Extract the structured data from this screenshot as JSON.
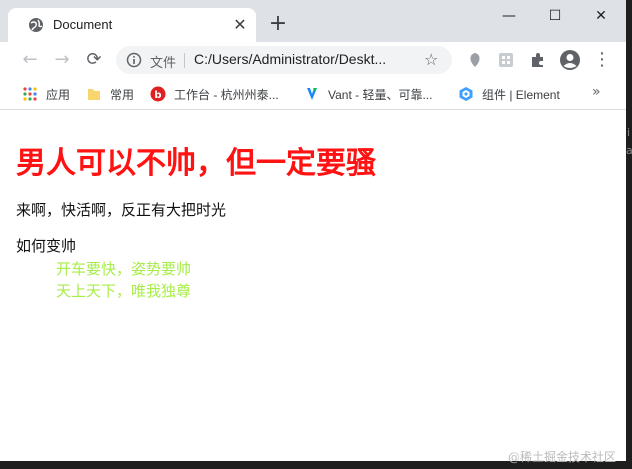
{
  "browser": {
    "tab_title": "Document",
    "tab_close": "✕",
    "new_tab": "+",
    "window_controls": {
      "minimize": "—",
      "maximize": "☐",
      "close": "✕"
    }
  },
  "toolbar": {
    "back_icon": "←",
    "forward_icon": "→",
    "reload_icon": "⟳",
    "address": {
      "scheme_label": "文件",
      "url": "C:/Users/Administrator/Deskt..."
    },
    "star_icon": "☆",
    "menu_icon": "⋮"
  },
  "bookmarks": [
    {
      "label": "应用",
      "icon": "apps-grid-icon"
    },
    {
      "label": "常用",
      "icon": "folder-icon"
    },
    {
      "label": "工作台 - 杭州州泰...",
      "icon": "site-red-icon"
    },
    {
      "label": "Vant - 轻量、可靠...",
      "icon": "vant-icon"
    },
    {
      "label": "组件 | Element",
      "icon": "element-icon"
    }
  ],
  "bookmarks_more": "»",
  "page": {
    "heading": "男人可以不帅，但一定要骚",
    "line1": "来啊，快活啊，反正有大把时光",
    "line2": "如何变帅",
    "list": [
      "开车要快，姿势要帅",
      "天上天下，唯我独尊"
    ]
  },
  "edge_text": {
    "a": "i",
    "b": "af"
  },
  "watermark": "@稀土掘金技术社区",
  "colors": {
    "heading": "#ff1212",
    "list": "#a8ee4a",
    "tabstrip": "#dee1e6"
  }
}
